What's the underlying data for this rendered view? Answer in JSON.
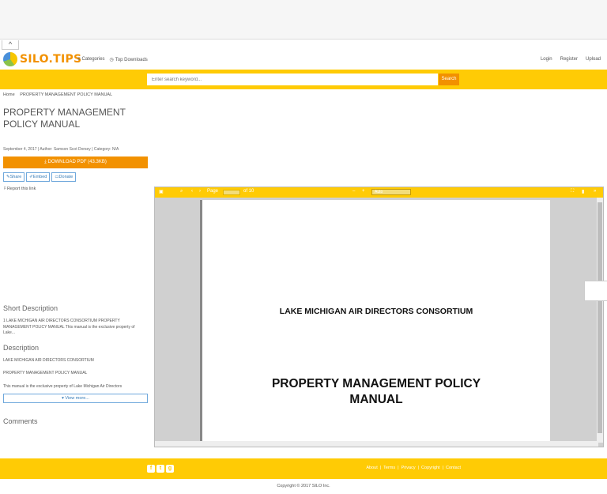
{
  "header": {
    "logo_text": "SILO.TIPS",
    "nav_left": [
      {
        "icon": "list-icon",
        "label": "Categories"
      },
      {
        "icon": "clock-icon",
        "label": "Top Downloads"
      }
    ],
    "nav_right": [
      "Login",
      "Register",
      "Upload"
    ]
  },
  "search": {
    "placeholder": "Enter search keyword...",
    "button_label": "Search"
  },
  "breadcrumb": [
    "Home",
    "PROPERTY MANAGEMENT POLICY MANUAL"
  ],
  "document": {
    "title": "PROPERTY MANAGEMENT POLICY MANUAL",
    "meta": "September 4, 2017 | Author: Samson Scot Dorsey | Category: N/A",
    "download_label": "DOWNLOAD PDF (43.3KB)",
    "actions": [
      {
        "icon": "share-icon",
        "label": "Share"
      },
      {
        "icon": "embed-icon",
        "label": "Embed"
      },
      {
        "icon": "donate-icon",
        "label": "Donate"
      }
    ],
    "report_label": "Report this link"
  },
  "short_description": {
    "heading": "Short Description",
    "text": "1 LAKE MICHIGAN AIR DIRECTORS CONSORTIUM PROPERTY MANAGEMENT POLICY MANUAL This manual is the exclusive property of Lake..."
  },
  "description": {
    "heading": "Description",
    "lines": [
      "LAKE MICHIGAN AIR DIRECTORS CONSORTIUM",
      "PROPERTY MANAGEMENT POLICY MANUAL",
      "This manual is the exclusive property of Lake Michigan Air Directors"
    ],
    "view_more_label": "View more..."
  },
  "comments": {
    "heading": "Comments"
  },
  "viewer": {
    "page_of": "of 10",
    "zoom": "Auto",
    "pdf_org": "LAKE MICHIGAN AIR DIRECTORS CONSORTIUM",
    "pdf_title_line1": "PROPERTY MANAGEMENT POLICY",
    "pdf_title_line2": "MANUAL"
  },
  "footer": {
    "links": [
      "About",
      "Terms",
      "Privacy",
      "Copyright",
      "Contact"
    ],
    "copyright": "Copyright © 2017 SILO Inc."
  },
  "colors": {
    "brand_yellow": "#ffcb05",
    "accent_orange": "#f29100"
  }
}
